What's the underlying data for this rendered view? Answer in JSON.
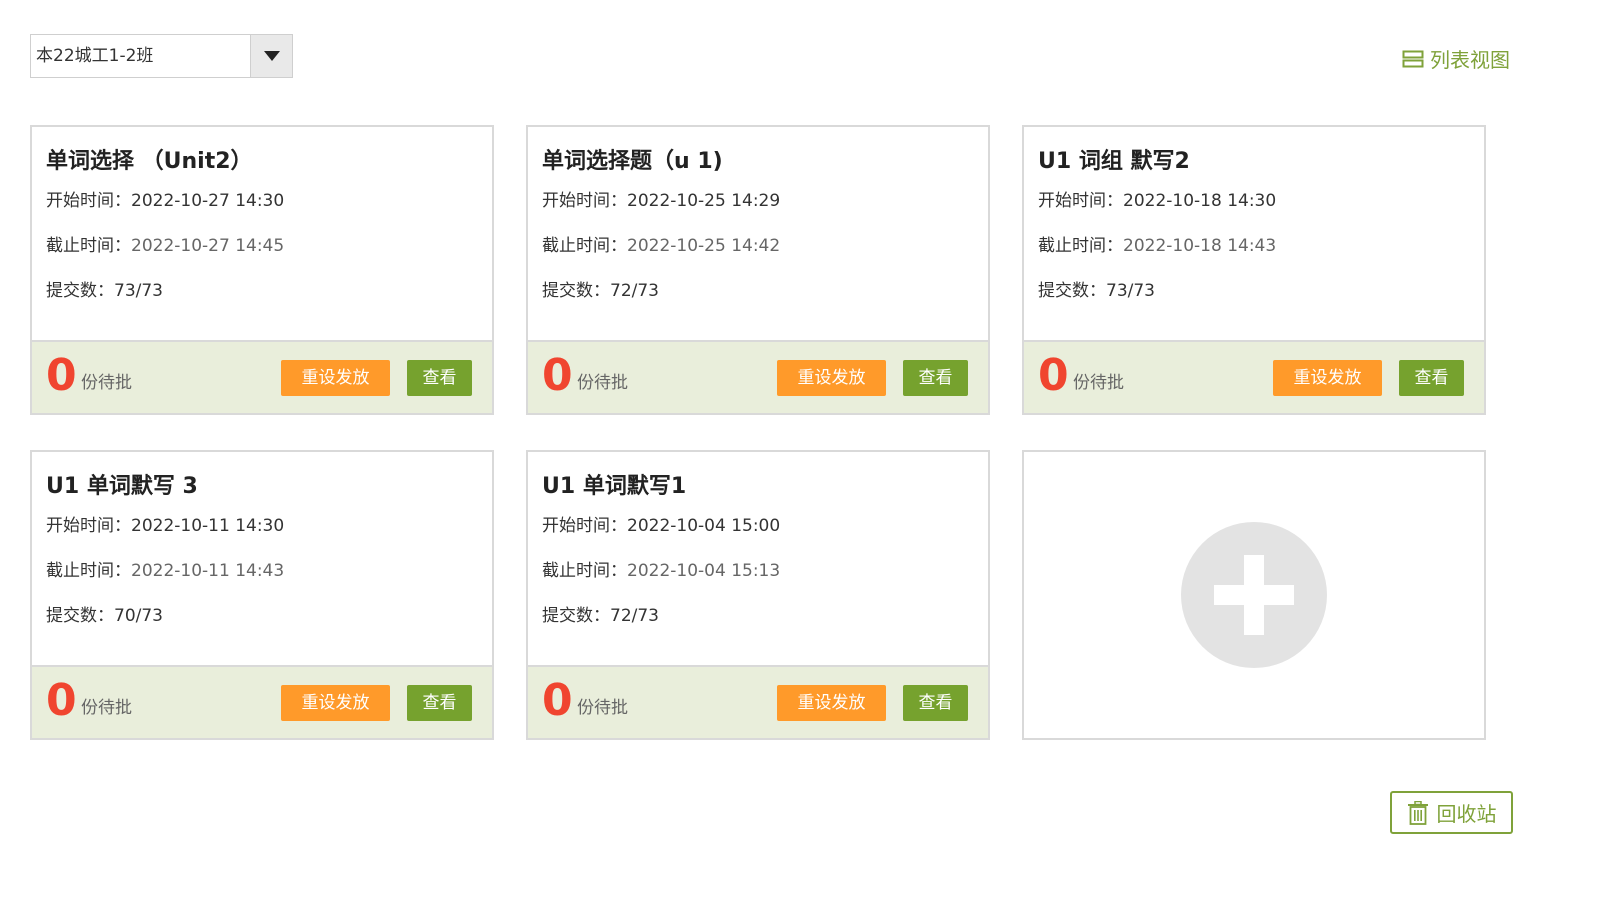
{
  "class_selector": {
    "value": "本22城工1-2班"
  },
  "list_view": {
    "label": "列表视图",
    "icon": "list-view-icon"
  },
  "cards": [
    {
      "title": "单词选择 （Unit2）",
      "start_label": "开始时间：",
      "start": "2022-10-27 14:30",
      "end_label": "截止时间：",
      "end": "2022-10-27 14:45",
      "submit_label": "提交数：",
      "submit": "73/73",
      "pending": "0",
      "pending_label": "份待批",
      "reset_label": "重设发放",
      "view_label": "查看"
    },
    {
      "title": "单词选择题（u 1)",
      "start_label": "开始时间：",
      "start": "2022-10-25 14:29",
      "end_label": "截止时间：",
      "end": "2022-10-25 14:42",
      "submit_label": "提交数：",
      "submit": "72/73",
      "pending": "0",
      "pending_label": "份待批",
      "reset_label": "重设发放",
      "view_label": "查看"
    },
    {
      "title": "U1 词组 默写2",
      "start_label": "开始时间：",
      "start": "2022-10-18 14:30",
      "end_label": "截止时间：",
      "end": "2022-10-18 14:43",
      "submit_label": "提交数：",
      "submit": "73/73",
      "pending": "0",
      "pending_label": "份待批",
      "reset_label": "重设发放",
      "view_label": "查看"
    },
    {
      "title": "U1 单词默写 3",
      "start_label": "开始时间：",
      "start": "2022-10-11 14:30",
      "end_label": "截止时间：",
      "end": "2022-10-11 14:43",
      "submit_label": "提交数：",
      "submit": "70/73",
      "pending": "0",
      "pending_label": "份待批",
      "reset_label": "重设发放",
      "view_label": "查看"
    },
    {
      "title": "U1 单词默写1",
      "start_label": "开始时间：",
      "start": "2022-10-04 15:00",
      "end_label": "截止时间：",
      "end": "2022-10-04 15:13",
      "submit_label": "提交数：",
      "submit": "72/73",
      "pending": "0",
      "pending_label": "份待批",
      "reset_label": "重设发放",
      "view_label": "查看"
    }
  ],
  "add_card": {
    "icon": "plus-icon"
  },
  "recycle_bin": {
    "label": "回收站",
    "icon": "trash-icon"
  },
  "colors": {
    "accent_green": "#7fa23a",
    "view_button": "#76a22e",
    "reset_button": "#ff9a2a",
    "pending_count": "#f0452f",
    "footer_bg": "#e9eedb"
  }
}
